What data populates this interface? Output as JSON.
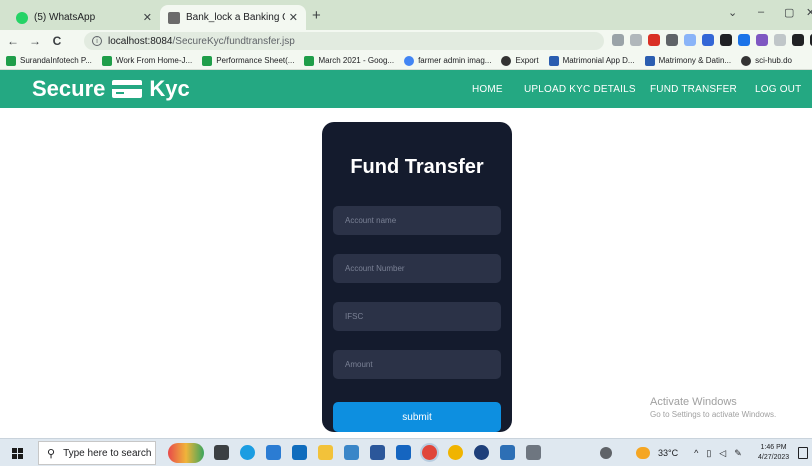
{
  "browser": {
    "tabs": [
      {
        "title": "(5) WhatsApp",
        "favicon_color": "#25d366"
      },
      {
        "title": "Bank_lock a Banking Category Fi",
        "favicon_color": "#6b6b6b"
      }
    ],
    "new_tab": "+",
    "close_glyph": "✕",
    "window_controls": [
      "⌄",
      "–",
      "▢",
      "✕"
    ],
    "nav": {
      "back": "←",
      "forward": "→",
      "reload": "C"
    },
    "address": {
      "host": "localhost:8084",
      "path": "/SecureKyc/fundtransfer.jsp"
    },
    "bookmarks": [
      {
        "label": "SurandaInfotech P...",
        "color": "#1f9e4a"
      },
      {
        "label": "Work From Home-J...",
        "color": "#1f9e4a"
      },
      {
        "label": "Performance Sheet(...",
        "color": "#1f9e4a"
      },
      {
        "label": "March 2021 - Goog...",
        "color": "#1f9e4a"
      },
      {
        "label": "farmer admin imag...",
        "color": "#4285f4"
      },
      {
        "label": "Export",
        "color": "#333333"
      },
      {
        "label": "Matrimonial App D...",
        "color": "#2a5db0"
      },
      {
        "label": "Matrimony & Datin...",
        "color": "#2a5db0"
      },
      {
        "label": "sci-hub.do",
        "color": "#333333"
      }
    ]
  },
  "site": {
    "logo_left": "Secure",
    "logo_right": "Kyc",
    "nav": [
      "HOME",
      "UPLOAD KYC DETAILS",
      "FUND TRANSFER",
      "LOG OUT"
    ],
    "accent": "#24a882"
  },
  "form": {
    "title": "Fund Transfer",
    "fields": [
      {
        "placeholder": "Account name"
      },
      {
        "placeholder": "Account Number"
      },
      {
        "placeholder": "IFSC"
      },
      {
        "placeholder": "Amount"
      }
    ],
    "submit_label": "submit",
    "card_color": "#141b2d",
    "button_color": "#0d8fe0"
  },
  "watermark": {
    "line1": "Activate Windows",
    "line2": "Go to Settings to activate Windows."
  },
  "taskbar": {
    "search_placeholder": "Type here to search",
    "weather": "33°C",
    "time": "1:46 PM",
    "date": "4/27/2023"
  }
}
